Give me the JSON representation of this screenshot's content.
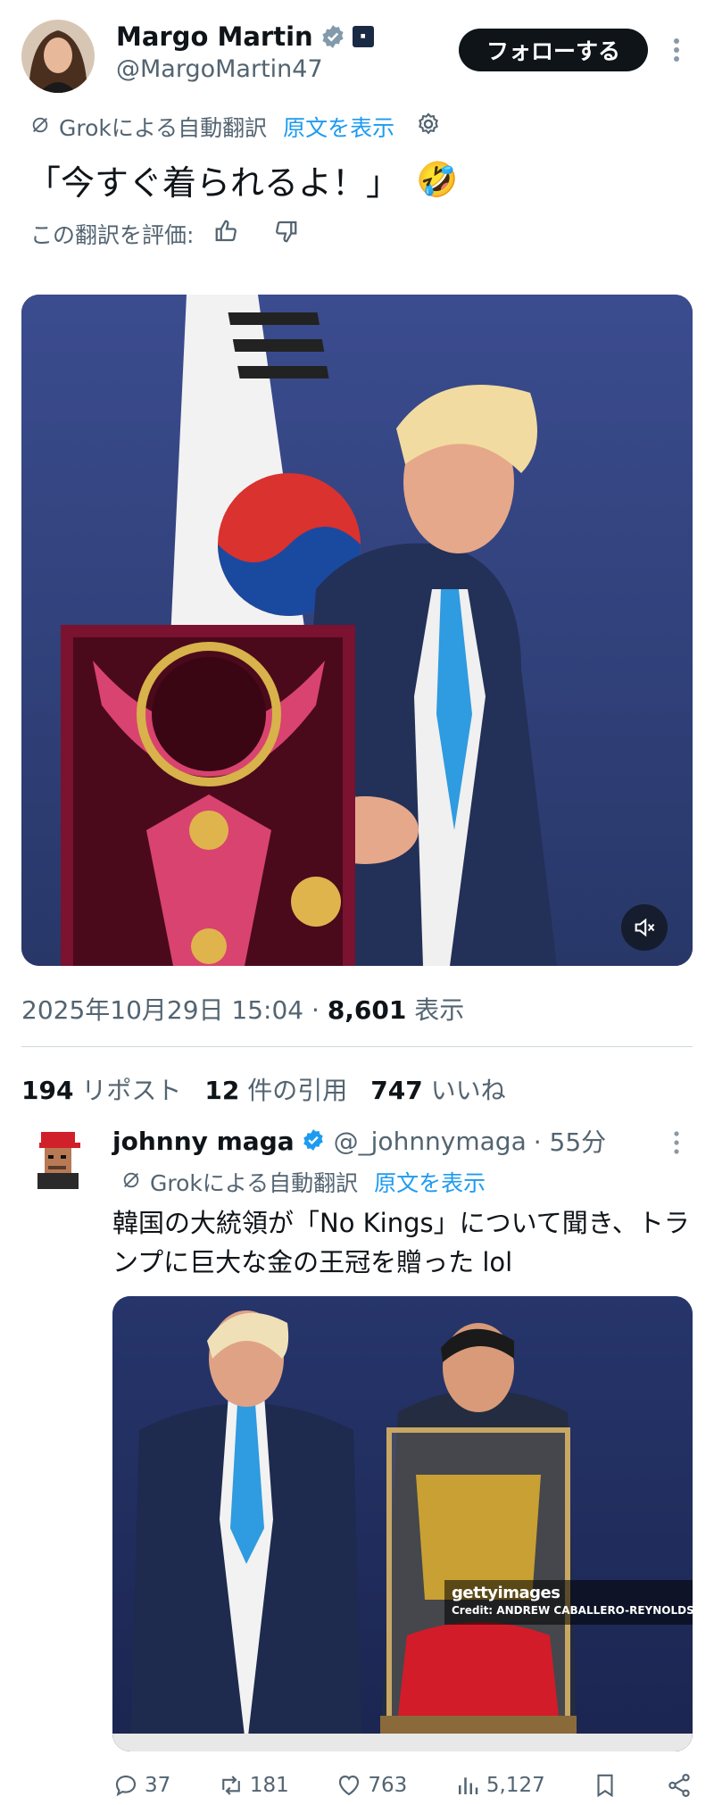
{
  "post": {
    "author_name": "Margo Martin",
    "author_handle": "@MargoMartin47",
    "follow_label": "フォローする",
    "translation_note": "Grokによる自動翻訳",
    "show_original": "原文を表示",
    "text": "「今すぐ着られるよ！」",
    "emoji": "🤣",
    "rate_label": "この翻訳を評価:",
    "timestamp": "2025年10月29日 15:04 · ",
    "views_count": "8,601",
    "views_label": " 表示",
    "reposts_count": "194",
    "reposts_label": " リポスト",
    "quotes_count": "12",
    "quotes_label": " 件の引用",
    "likes_count": "747",
    "likes_label": " いいね"
  },
  "quote": {
    "author_name": "johnny maga",
    "author_handle": "@_johnnymaga",
    "time": "· 55分",
    "translation_note": "Grokによる自動翻訳",
    "show_original": "原文を表示",
    "text": "韓国の大統領が「No Kings」について聞き、トランプに巨大な金の王冠を贈った lol",
    "image_credit_brand": "gettyimages",
    "image_credit": "Credit: ANDREW CABALLERO-REYNOLDS",
    "replies": "37",
    "reposts": "181",
    "likes": "763",
    "views": "5,127"
  },
  "colors": {
    "accent": "#1d9bf0",
    "text": "#0f1419",
    "muted": "#536471",
    "follow_bg": "#0f1419"
  },
  "icons": [
    "verified-icon",
    "org-badge-icon",
    "more-icon",
    "translate-icon",
    "settings-icon",
    "thumbs-up-icon",
    "thumbs-down-icon",
    "mute-icon",
    "reply-icon",
    "repost-icon",
    "like-icon",
    "views-icon",
    "bookmark-icon",
    "share-icon"
  ]
}
